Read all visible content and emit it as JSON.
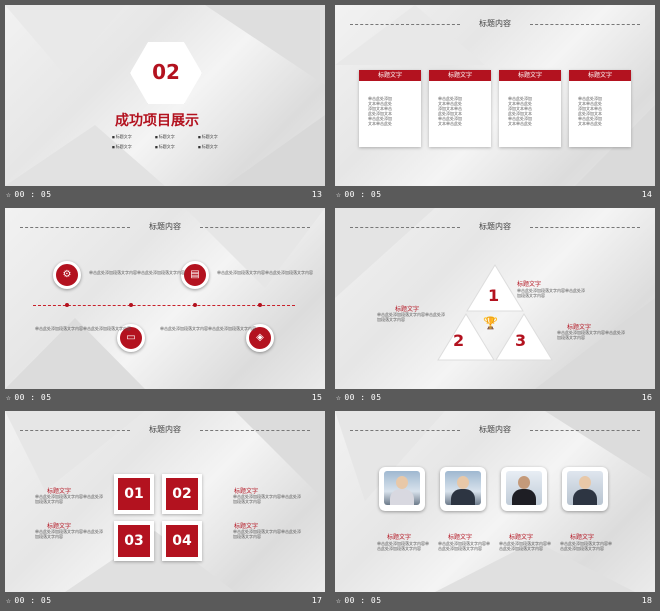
{
  "slides": [
    {
      "number": "13",
      "time": "00 : 05",
      "badge": "02",
      "title": "成功项目展示",
      "bullets": [
        "标题文字",
        "标题文字",
        "标题文字",
        "标题文字",
        "标题文字",
        "标题文字"
      ]
    },
    {
      "number": "14",
      "time": "00 : 05",
      "header": "标题内容",
      "cards": [
        {
          "title": "标题文字",
          "lines": [
            "单击此处添加",
            "文本单击此处",
            "添加文本单击",
            "此处添加文本",
            "单击此处添加",
            "文本单击此处"
          ]
        },
        {
          "title": "标题文字",
          "lines": [
            "单击此处添加",
            "文本单击此处",
            "添加文本单击",
            "此处添加文本",
            "单击此处添加",
            "文本单击此处"
          ]
        },
        {
          "title": "标题文字",
          "lines": [
            "单击此处添加",
            "文本单击此处",
            "添加文本单击",
            "此处添加文本",
            "单击此处添加",
            "文本单击此处"
          ]
        },
        {
          "title": "标题文字",
          "lines": [
            "单击此处添加",
            "文本单击此处",
            "添加文本单击",
            "此处添加文本",
            "单击此处添加",
            "文本单击此处"
          ]
        }
      ]
    },
    {
      "number": "15",
      "time": "00 : 05",
      "header": "标题内容",
      "texts": [
        "单击此处添加段落文字内容单击此处添加段落文字内容",
        "单击此处添加段落文字内容单击此处添加段落文字内容",
        "单击此处添加段落文字内容单击此处添加段落文字内容",
        "单击此处添加段落文字内容单击此处添加段落文字内容"
      ]
    },
    {
      "number": "16",
      "time": "00 : 05",
      "header": "标题内容",
      "items": [
        {
          "title": "标题文字",
          "num": "1"
        },
        {
          "title": "标题文字",
          "num": "2"
        },
        {
          "title": "标题文字",
          "num": "3"
        }
      ],
      "desc": "单击此处添加段落文字内容单击此处添加段落文字内容"
    },
    {
      "number": "17",
      "time": "00 : 05",
      "header": "标题内容",
      "boxes": [
        "01",
        "02",
        "03",
        "04"
      ],
      "labels": [
        "标题文字",
        "标题文字",
        "标题文字",
        "标题文字"
      ],
      "desc": "单击此处添加段落文字内容单击此处添加段落文字内容"
    },
    {
      "number": "18",
      "time": "00 : 05",
      "header": "标题内容",
      "people": [
        "标题文字",
        "标题文字",
        "标题文字",
        "标题文字"
      ],
      "desc": "单击此处添加段落文字内容单击此处添加段落文字内容"
    }
  ],
  "colors": {
    "accent": "#b3121f",
    "bar": "#5a5a5a"
  }
}
